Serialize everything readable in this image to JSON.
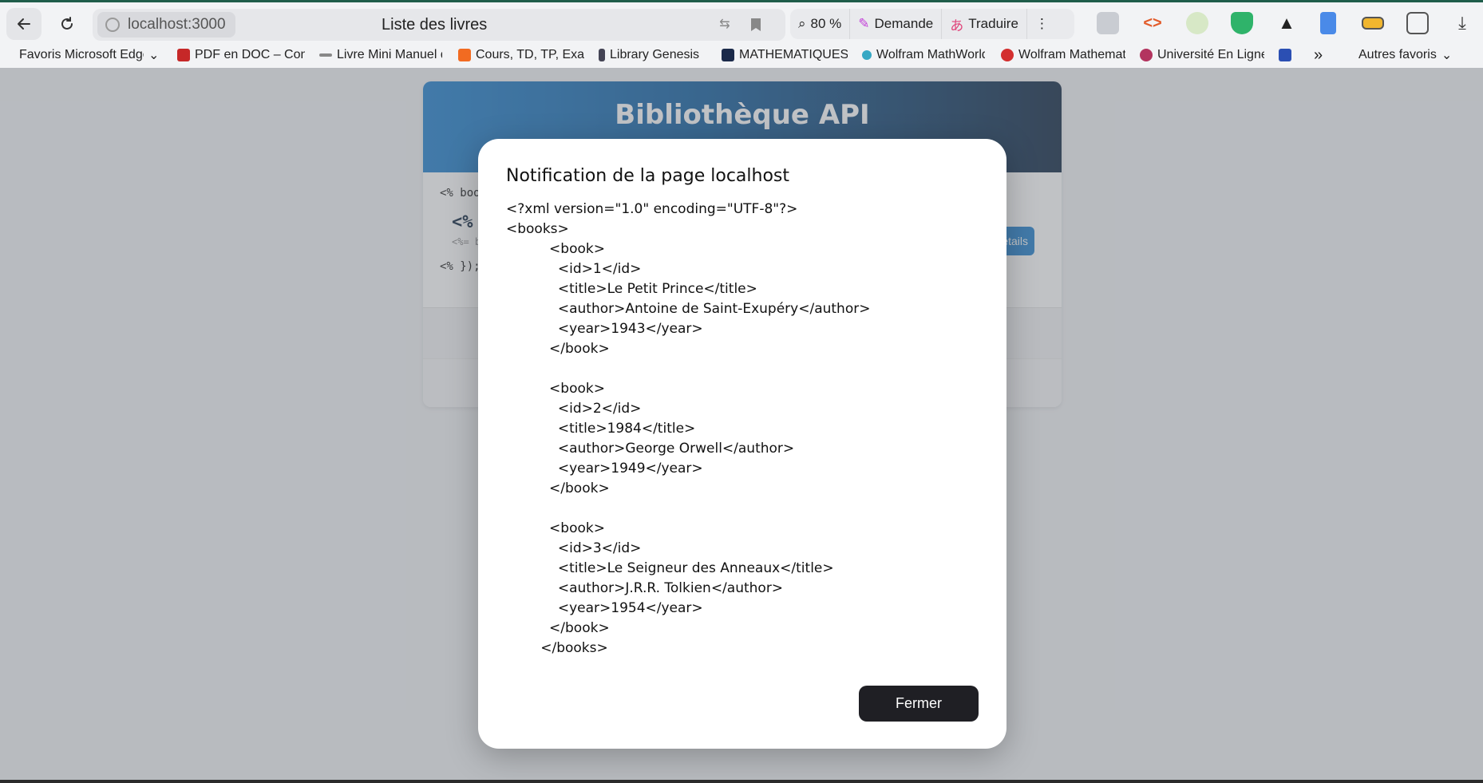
{
  "browser": {
    "url": "localhost:3000",
    "page_title": "Liste des livres",
    "zoom": "80 %",
    "pill_ask": "Demande",
    "pill_translate": "Traduire",
    "more": "⋮"
  },
  "bookmarks": {
    "items": [
      "Favoris Microsoft Edge",
      "PDF en DOC – Convert",
      "Livre Mini Manuel de",
      "Cours, TD, TP, Exam",
      "Library Genesis",
      "MATHEMATIQUES",
      "Wolfram MathWorld",
      "Wolfram Mathematica",
      "Université En Ligne"
    ],
    "overflow": "»",
    "other": "Autres favoris"
  },
  "app": {
    "title": "Bibliothèque API",
    "tmpl_1": "<% books.forEach(book => { %>",
    "tmpl_2": "<%",
    "tmpl_3": "<%= book.author %>",
    "tmpl_4": "<% }); %>",
    "details_label": "Détails"
  },
  "dialog": {
    "title": "Notification de la page localhost",
    "message": "<?xml version=\"1.0\" encoding=\"UTF-8\"?>\n<books>\n          <book>\n            <id>1</id>\n            <title>Le Petit Prince</title>\n            <author>Antoine de Saint-Exupéry</author>\n            <year>1943</year>\n          </book>\n\n          <book>\n            <id>2</id>\n            <title>1984</title>\n            <author>George Orwell</author>\n            <year>1949</year>\n          </book>\n\n          <book>\n            <id>3</id>\n            <title>Le Seigneur des Anneaux</title>\n            <author>J.R.R. Tolkien</author>\n            <year>1954</year>\n          </book>\n        </books>",
    "close_label": "Fermer"
  },
  "colors": {
    "header_start": "#3a8fd4",
    "header_end": "#2b3f57",
    "dialog_button": "#1f1f24"
  }
}
